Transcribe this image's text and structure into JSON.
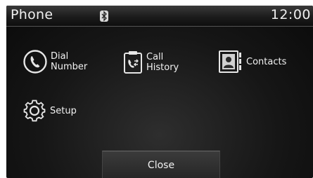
{
  "header": {
    "title": "Phone",
    "clock": "12:00",
    "bluetooth_icon": "bluetooth-icon"
  },
  "menu": {
    "dial": {
      "line1": "Dial",
      "line2": "Number",
      "icon": "phone-handset-icon"
    },
    "call_history": {
      "line1": "Call",
      "line2": "History",
      "icon": "call-history-icon"
    },
    "contacts": {
      "label": "Contacts",
      "icon": "contacts-icon"
    },
    "setup": {
      "label": "Setup",
      "icon": "gear-icon"
    }
  },
  "footer": {
    "close_label": "Close"
  }
}
